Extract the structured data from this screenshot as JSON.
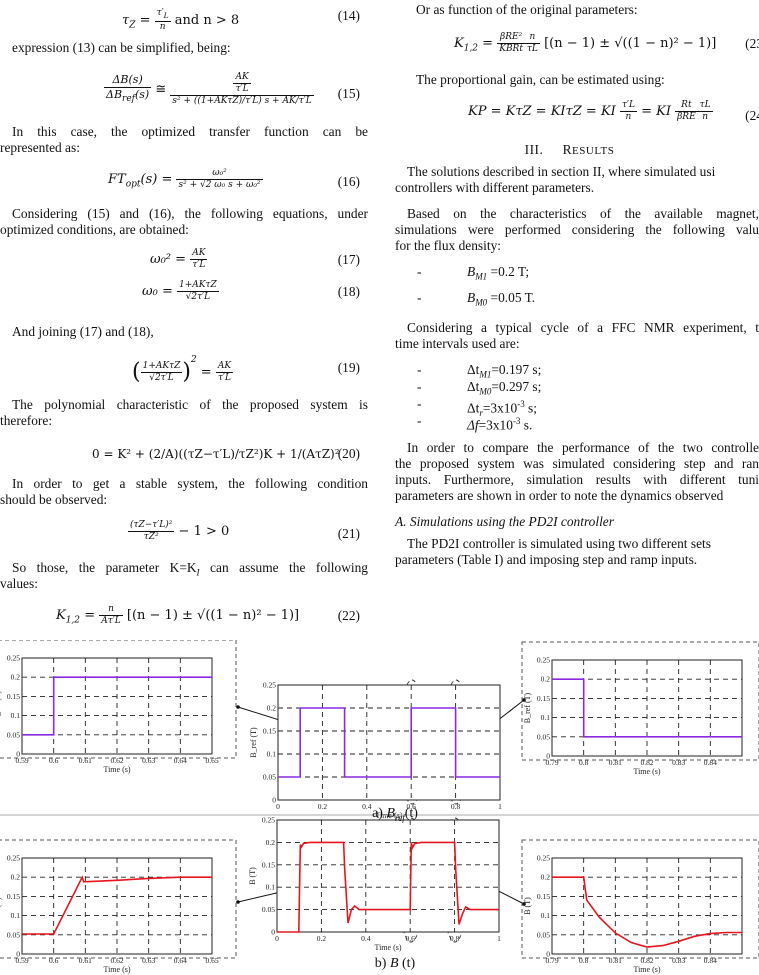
{
  "left": {
    "eq14": {
      "text": "τ_Z = τ′_L / n and n > 8",
      "lhs": "τ",
      "sub": "Z",
      "num": "τ′",
      "numsub": "L",
      "den": "n",
      "tail": " and n > 8",
      "number": "(14)"
    },
    "p1": "expression (13) can be simplified, being:",
    "eq15": {
      "lhs_num": "ΔB(s)",
      "lhs_den": "ΔB",
      "lhs_den_sub": "ref",
      "lhs_den_tail": "(s)",
      "approx": "≅",
      "rhs_num_top": "AK",
      "rhs_num_bot": "τ′L",
      "rhs_den": "s² + ((1+AKτZ)/τ′L) s + AK/τ′L",
      "number": "(15)"
    },
    "p2a": "In this case, the optimized transfer function can be",
    "p2b": "represented as:",
    "eq16": {
      "lhs": "FT",
      "lhs_sub": "opt",
      "lhs_tail": "(s) =",
      "num": "ω₀²",
      "den": "s² + √2 ω₀ s + ω₀²",
      "number": "(16)"
    },
    "p3a": "Considering (15) and (16), the following equations, under",
    "p3b": "optimized conditions, are obtained:",
    "eq17": {
      "lhs": "ω₀² =",
      "num": "AK",
      "den": "τ′L",
      "number": "(17)"
    },
    "eq18": {
      "lhs": "ω₀ =",
      "num": "1+AKτZ",
      "den": "√2τ′L",
      "number": "(18)"
    },
    "p4": "And joining (17) and (18),",
    "eq19": {
      "num": "1+AKτZ",
      "den": "√2τ′L",
      "rhs_num": "AK",
      "rhs_den": "τ′L",
      "number": "(19)"
    },
    "p5a": "The polynomial characteristic of the proposed system is",
    "p5b": "therefore:",
    "eq20": {
      "text": "0 = K² + (2/A)((τZ−τ′L)/τZ²)K + 1/(AτZ)²",
      "number": "(20)"
    },
    "p6a": "In order to get a stable system, the following condition",
    "p6b": "should be observed:",
    "eq21": {
      "num": "(τZ−τ′L)²",
      "den": "τZ²",
      "tail": "− 1 > 0",
      "number": "(21)"
    },
    "p7a": "So those, the parameter K=K",
    "p7sub": "I",
    "p7b": " can assume the following",
    "p7c": "values:",
    "eq22": {
      "lhs": "K",
      "lhs_sub": "1,2",
      "eqs": "=",
      "num": "n",
      "den": "Aτ′L",
      "bracket": "[(n − 1) ± √((1 − n)² − 1)]",
      "number": "(22)"
    }
  },
  "right": {
    "p1": "Or as function of the original parameters:",
    "eq23": {
      "lhs": "K",
      "lhs_sub": "1,2",
      "num1": "βRE²",
      "den1": "KBRt",
      "num2": "n",
      "den2": "τL",
      "bracket": "[(n − 1) ± √((1 − n)² − 1)]",
      "number": "(23"
    },
    "p2": "The proportional gain, can be estimated using:",
    "eq24": {
      "text": "KP = KτZ = KIτZ = KI",
      "num1": "τ′L",
      "den1": "n",
      "mid": "= KI",
      "num2": "Rt",
      "den2": "βRE",
      "num3": "τL",
      "den3": "n",
      "number": "(24"
    },
    "heading_num": "III.",
    "heading_first": "R",
    "heading_rest": "ESULTS",
    "p3a": "The solutions described in section II, where simulated usi",
    "p3b": "controllers with different parameters.",
    "p4a": "Based on the characteristics of the available magnet,",
    "p4b": "simulations were performed considering the following valu",
    "p4c": "for the flux density:",
    "bullets1": [
      {
        "dash": "-",
        "sym": "B",
        "sub": "M1",
        "val": " =0.2 T;"
      },
      {
        "dash": "-",
        "sym": "B",
        "sub": "M0",
        "val": " =0.05 T."
      }
    ],
    "p5a": "Considering a typical cycle of a FFC NMR experiment, t",
    "p5b": "time intervals used are:",
    "bullets2": [
      {
        "dash": "-",
        "sym": "Δt",
        "sub": "M1",
        "val": "=0.197 s;"
      },
      {
        "dash": "-",
        "sym": "Δt",
        "sub": "M0",
        "val": "=0.297 s;"
      },
      {
        "dash": "-",
        "sym": "Δt",
        "sub": "r",
        "val": "=3x10",
        "sup": "-3",
        "tail": " s;"
      },
      {
        "dash": "-",
        "sym": "Δf",
        "sub": "",
        "val": "=3x10",
        "sup": "-3",
        "tail": " s."
      }
    ],
    "p6a": "In order to compare the performance of the two controlle",
    "p6b": "the proposed system was simulated considering step and ran",
    "p6c": "inputs. Furthermore, simulation results with different tuni",
    "p6d": "parameters are shown in order to note the dynamics observed",
    "subheading": "A.   Simulations using the PD2I controller",
    "p7a": "The PD2I controller is simulated using two different sets",
    "p7b": "parameters (Table I) and imposing step and ramp inputs."
  },
  "figure": {
    "caption_a_prefix": "a) ",
    "caption_a_sym": "B",
    "caption_a_sub": "ref",
    "caption_a_tail": "(t)",
    "caption_b_prefix": "b) ",
    "caption_b_sym": "B",
    "caption_b_tail": " (t)",
    "colors": {
      "ref": "#8a2be2",
      "b": "#e8141e",
      "grid": "#222222"
    }
  },
  "chart_data": [
    {
      "id": "a-left-zoom",
      "type": "line",
      "title": "",
      "xlabel": "Time (s)",
      "ylabel": "B_ref (T)",
      "xlim": [
        0.59,
        0.65
      ],
      "ylim": [
        0,
        0.25
      ],
      "xticks": [
        "0.59",
        "0.6",
        "0.61",
        "0.62",
        "0.63",
        "0.64",
        "0.65"
      ],
      "yticks": [
        "0",
        "0.05",
        "0.1",
        "0.15",
        "0.2",
        "0.25"
      ],
      "grid": true,
      "series": [
        {
          "name": "B_ref",
          "color": "#8a2be2",
          "x": [
            0.59,
            0.6,
            0.6,
            0.65
          ],
          "y": [
            0.05,
            0.05,
            0.2,
            0.2
          ]
        }
      ]
    },
    {
      "id": "a-main",
      "type": "line",
      "title": "",
      "xlabel": "Time (s)",
      "ylabel": "B_ref (T)",
      "xlim": [
        0,
        1
      ],
      "ylim": [
        0,
        0.25
      ],
      "xticks": [
        "0",
        "0.2",
        "0.4",
        "0.6",
        "0.8",
        "1"
      ],
      "yticks": [
        "0",
        "0.05",
        "0.1",
        "0.15",
        "0.2",
        "0.25"
      ],
      "grid": true,
      "series": [
        {
          "name": "B_ref",
          "color": "#8a2be2",
          "x": [
            0,
            0.1,
            0.1,
            0.3,
            0.3,
            0.6,
            0.6,
            0.8,
            0.8,
            1.0
          ],
          "y": [
            0.05,
            0.05,
            0.2,
            0.2,
            0.05,
            0.05,
            0.2,
            0.2,
            0.05,
            0.05
          ]
        }
      ]
    },
    {
      "id": "a-right-zoom",
      "type": "line",
      "title": "",
      "xlabel": "Time (s)",
      "ylabel": "B_ref (T)",
      "xlim": [
        0.79,
        0.85
      ],
      "ylim": [
        0,
        0.25
      ],
      "xticks": [
        "0.79",
        "0.8",
        "0.81",
        "0.82",
        "0.83",
        "0.84"
      ],
      "yticks": [
        "0",
        "0.05",
        "0.1",
        "0.15",
        "0.2",
        "0.25"
      ],
      "grid": true,
      "series": [
        {
          "name": "B_ref",
          "color": "#8a2be2",
          "x": [
            0.79,
            0.8,
            0.8,
            0.85
          ],
          "y": [
            0.2,
            0.2,
            0.05,
            0.05
          ]
        }
      ]
    },
    {
      "id": "b-left-zoom",
      "type": "line",
      "title": "",
      "xlabel": "Time (s)",
      "ylabel": "B (T)",
      "xlim": [
        0.59,
        0.65
      ],
      "ylim": [
        0,
        0.25
      ],
      "xticks": [
        "0.59",
        "0.6",
        "0.61",
        "0.62",
        "0.63",
        "0.64",
        "0.65"
      ],
      "yticks": [
        "0",
        "0.05",
        "0.1",
        "0.15",
        "0.2",
        "0.25"
      ],
      "grid": true,
      "series": [
        {
          "name": "B",
          "color": "#e8141e",
          "x": [
            0.59,
            0.6,
            0.609,
            0.6095,
            0.62,
            0.63,
            0.64,
            0.65
          ],
          "y": [
            0.052,
            0.052,
            0.2,
            0.188,
            0.192,
            0.197,
            0.2,
            0.2
          ]
        }
      ]
    },
    {
      "id": "b-main",
      "type": "line",
      "title": "",
      "xlabel": "Time (s)",
      "ylabel": "B (T)",
      "xlim": [
        0,
        1
      ],
      "ylim": [
        0,
        0.25
      ],
      "xticks": [
        "0",
        "0.2",
        "0.4",
        "0.6",
        "0.8",
        "1"
      ],
      "yticks": [
        "0",
        "0.05",
        "0.1",
        "0.15",
        "0.2",
        "0.25"
      ],
      "grid": true,
      "series": [
        {
          "name": "B",
          "color": "#e8141e",
          "x": [
            0,
            0.098,
            0.105,
            0.11,
            0.12,
            0.15,
            0.3,
            0.305,
            0.32,
            0.335,
            0.35,
            0.37,
            0.4,
            0.6,
            0.605,
            0.61,
            0.62,
            0.65,
            0.8,
            0.805,
            0.82,
            0.835,
            0.85,
            0.87,
            0.9,
            1.0
          ],
          "y": [
            0,
            0,
            0.195,
            0.19,
            0.198,
            0.2,
            0.2,
            0.14,
            0.02,
            0.05,
            0.058,
            0.05,
            0.05,
            0.05,
            0.2,
            0.188,
            0.197,
            0.2,
            0.2,
            0.14,
            0.017,
            0.04,
            0.056,
            0.05,
            0.05,
            0.05
          ]
        }
      ]
    },
    {
      "id": "b-right-zoom",
      "type": "line",
      "title": "",
      "xlabel": "Time (s)",
      "ylabel": "B (T)",
      "xlim": [
        0.79,
        0.85
      ],
      "ylim": [
        0,
        0.25
      ],
      "xticks": [
        "0.79",
        "0.8",
        "0.81",
        "0.82",
        "0.83",
        "0.84"
      ],
      "yticks": [
        "0",
        "0.05",
        "0.1",
        "0.15",
        "0.2",
        "0.25"
      ],
      "grid": true,
      "series": [
        {
          "name": "B",
          "color": "#e8141e",
          "x": [
            0.79,
            0.8,
            0.8005,
            0.801,
            0.805,
            0.81,
            0.815,
            0.82,
            0.825,
            0.83,
            0.835,
            0.84,
            0.845,
            0.85
          ],
          "y": [
            0.2,
            0.2,
            0.17,
            0.14,
            0.095,
            0.055,
            0.03,
            0.018,
            0.022,
            0.033,
            0.046,
            0.053,
            0.056,
            0.056
          ]
        }
      ]
    }
  ]
}
